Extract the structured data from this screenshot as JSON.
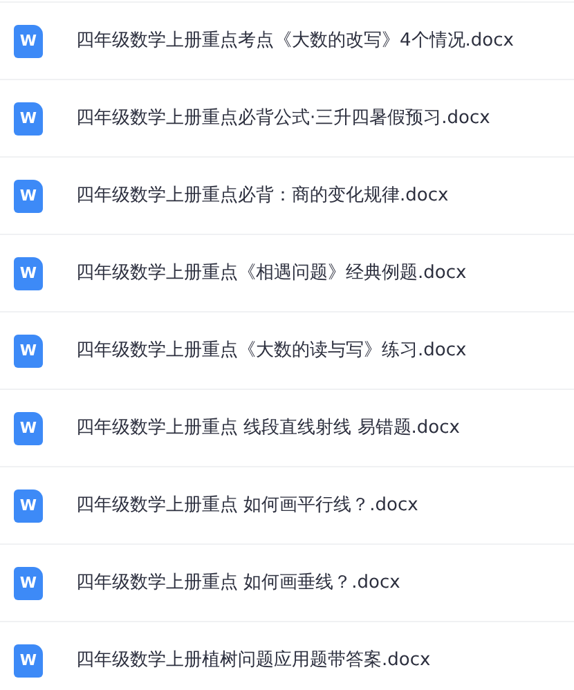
{
  "files": [
    {
      "icon_label": "W",
      "name": "四年级数学上册重点考点《大数的改写》4个情况.docx"
    },
    {
      "icon_label": "W",
      "name": "四年级数学上册重点必背公式·三升四暑假预习.docx"
    },
    {
      "icon_label": "W",
      "name": "四年级数学上册重点必背：商的变化规律.docx"
    },
    {
      "icon_label": "W",
      "name": "四年级数学上册重点《相遇问题》经典例题.docx"
    },
    {
      "icon_label": "W",
      "name": "四年级数学上册重点《大数的读与写》练习.docx"
    },
    {
      "icon_label": "W",
      "name": "四年级数学上册重点 线段直线射线 易错题.docx"
    },
    {
      "icon_label": "W",
      "name": "四年级数学上册重点 如何画平行线？.docx"
    },
    {
      "icon_label": "W",
      "name": "四年级数学上册重点 如何画垂线？.docx"
    },
    {
      "icon_label": "W",
      "name": "四年级数学上册植树问题应用题带答案.docx"
    }
  ]
}
